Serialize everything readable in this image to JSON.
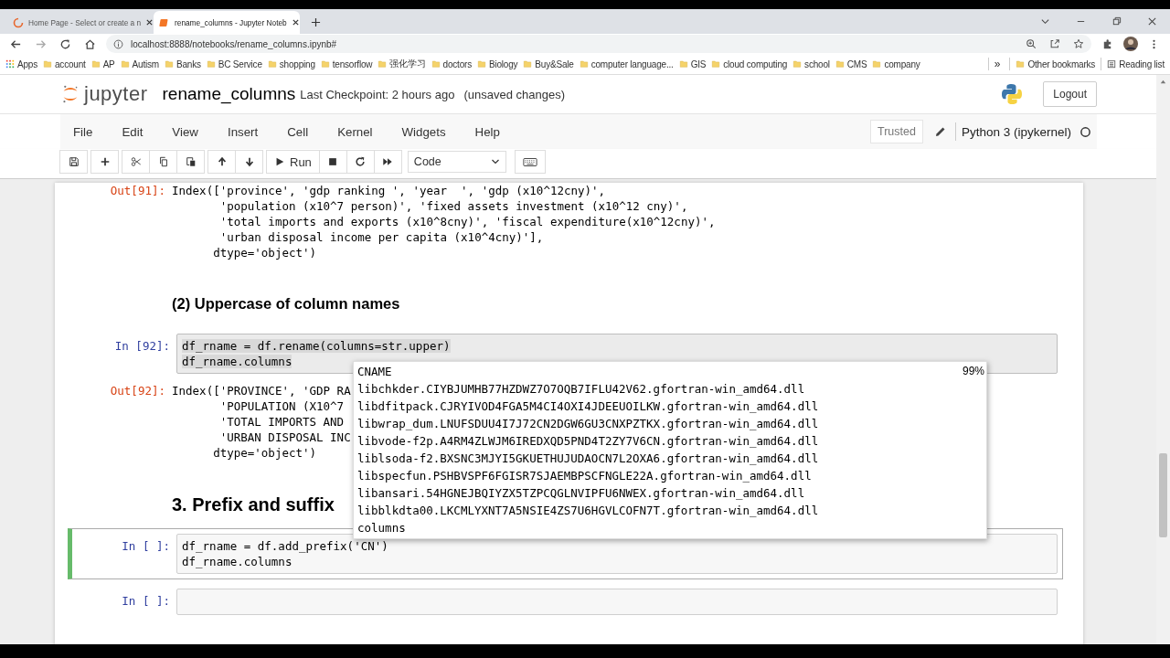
{
  "browser": {
    "tabs": [
      {
        "title": "Home Page - Select or create a n",
        "selected": false
      },
      {
        "title": "rename_columns - Jupyter Noteb",
        "selected": true
      }
    ],
    "address": "localhost:8888/notebooks/rename_columns.ipynb#",
    "bookmarks": [
      "account",
      "AP",
      "Autism",
      "Banks",
      "BC Service",
      "shopping",
      "tensorflow",
      "强化学习",
      "doctors",
      "Biology",
      "Buy&Sale",
      "computer language...",
      "GIS",
      "cloud computing",
      "school",
      "CMS",
      "company"
    ],
    "apps": "Apps",
    "more": "»",
    "other_bookmarks": "Other bookmarks",
    "reading_list": "Reading list"
  },
  "jupyter": {
    "logo_text": "jupyter",
    "notebook_name": "rename_columns",
    "checkpoint": "Last Checkpoint: 2 hours ago",
    "unsaved": "(unsaved changes)",
    "logout": "Logout",
    "menu": [
      "File",
      "Edit",
      "View",
      "Insert",
      "Cell",
      "Kernel",
      "Widgets",
      "Help"
    ],
    "trusted": "Trusted",
    "kernel": "Python 3 (ipykernel)",
    "run": "Run",
    "cell_type": "Code"
  },
  "cells": [
    {
      "kind": "output",
      "prompt": "Out[91]:",
      "lines": [
        "Index(['province', 'gdp ranking ', 'year  ', 'gdp (x10^12cny)',",
        "       'population (x10^7 person)', 'fixed assets investment (x10^12 cny)',",
        "       'total imports and exports (x10^8cny)', 'fiscal expenditure(x10^12cny)',",
        "       'urban disposal income per capita (x10^4cny)'],",
        "      dtype='object')"
      ]
    },
    {
      "kind": "subheading",
      "text": "(2) Uppercase of column names"
    },
    {
      "kind": "code",
      "prompt": "In [92]:",
      "lines": [
        "df_rname = df.rename(columns=str.upper)",
        "df_rname.columns"
      ],
      "selected": false,
      "highlighted": true
    },
    {
      "kind": "output",
      "prompt": "Out[92]:",
      "lines": [
        "Index(['PROVINCE', 'GDP RA",
        "       'POPULATION (X10^7",
        "       'TOTAL IMPORTS AND",
        "       'URBAN DISPOSAL INC",
        "      dtype='object')"
      ]
    },
    {
      "kind": "heading",
      "text": "3. Prefix and suffix"
    },
    {
      "kind": "code",
      "prompt": "In [ ]:",
      "lines": [
        "df_rname = df.add_prefix('CN')",
        "df_rname.columns"
      ],
      "selected": true,
      "highlighted": false
    },
    {
      "kind": "code",
      "prompt": "In [ ]:",
      "selected": false,
      "highlighted": false
    }
  ],
  "completer": {
    "percent": "99%",
    "items": [
      "CNAME",
      "libchkder.CIYBJUMHB77HZDWZ7O7OQB7IFLU42V62.gfortran-win_amd64.dll",
      "libdfitpack.CJRYIVOD4FGA5M4CI4OXI4JDEEUOILKW.gfortran-win_amd64.dll",
      "libwrap_dum.LNUFSDUU4I7J72CN2DGW6GU3CNXPZTKX.gfortran-win_amd64.dll",
      "libvode-f2p.A4RM4ZLWJM6IREDXQD5PND4T2ZY7V6CN.gfortran-win_amd64.dll",
      "liblsoda-f2.BXSNC3MJYI5GKUETHUJUDAOCN7L2OXA6.gfortran-win_amd64.dll",
      "libspecfun.PSHBVSPF6FGISR7SJAEMBPSCFNGLE22A.gfortran-win_amd64.dll",
      "libansari.54HGNEJBQIYZX5TZPCQGLNVIPFU6NWEX.gfortran-win_amd64.dll",
      "libblkdta00.LKCMLYXNT7A5NSIE4ZS7U6HGVLCOFN7T.gfortran-win_amd64.dll",
      "columns"
    ]
  }
}
